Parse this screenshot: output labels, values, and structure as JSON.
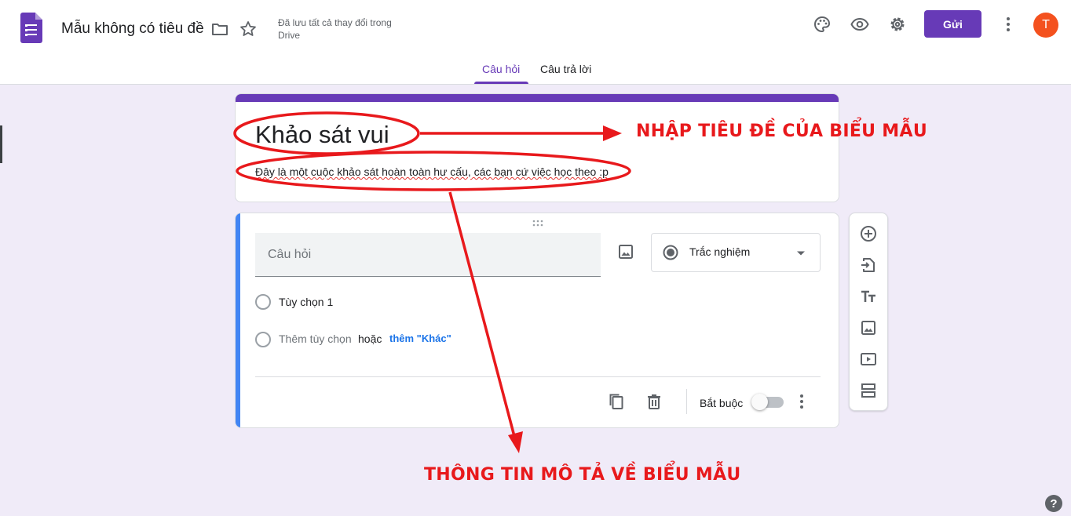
{
  "header": {
    "doc_title": "Mẫu không có tiêu đề",
    "save_status_line1": "Đã lưu tất cả thay đổi trong",
    "save_status_line2": "Drive",
    "send_label": "Gửi",
    "avatar_letter": "T"
  },
  "tabs": [
    {
      "label": "Câu hỏi",
      "active": true
    },
    {
      "label": "Câu trả lời",
      "active": false
    }
  ],
  "form": {
    "title": "Khảo sát vui",
    "description": "Đây là một cuộc khảo sát hoàn toàn hư cấu, các bạn cứ việc học theo :p"
  },
  "question": {
    "placeholder": "Câu hỏi",
    "type_label": "Trắc nghiệm",
    "option1": "Tùy chọn 1",
    "add_option": "Thêm tùy chọn",
    "or": "hoặc",
    "add_other": "thêm \"Khác\"",
    "required_label": "Bắt buộc"
  },
  "annotations": {
    "title_note": "NHẬP TIÊU ĐỀ CỦA BIỂU MẪU",
    "desc_note": "THÔNG TIN MÔ TẢ VỀ BIỂU MẪU"
  },
  "colors": {
    "accent": "#673ab7",
    "annotation": "#e8191c",
    "question_bar": "#4285f4",
    "background": "#f0ebf8"
  },
  "icons": [
    "forms-logo-icon",
    "folder-icon",
    "star-icon",
    "palette-icon",
    "eye-icon",
    "gear-icon",
    "more-vert-icon",
    "drag-handle-icon",
    "image-icon",
    "radio-icon",
    "dropdown-arrow-icon",
    "copy-icon",
    "trash-icon",
    "add-question-icon",
    "import-icon",
    "title-icon",
    "add-image-icon",
    "video-icon",
    "section-icon",
    "help-icon"
  ]
}
